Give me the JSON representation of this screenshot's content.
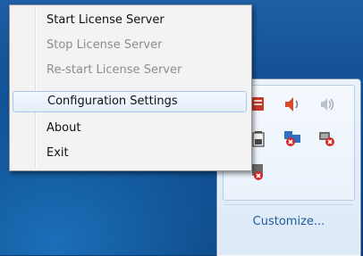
{
  "menu": {
    "items": [
      {
        "label": "Start License Server",
        "enabled": true
      },
      {
        "label": "Stop License Server",
        "enabled": false
      },
      {
        "label": "Re-start License Server",
        "enabled": false
      },
      {
        "label": "Configuration Settings",
        "enabled": true,
        "highlighted": true
      },
      {
        "label": "About",
        "enabled": true
      },
      {
        "label": "Exit",
        "enabled": true
      }
    ]
  },
  "tray": {
    "customize_label": "Customize...",
    "icons": [
      "license-server-icon",
      "volume-icon",
      "speaker-icon",
      "battery-icon",
      "network-error-icon",
      "network-disconnected-icon",
      "license-server-stopped-icon"
    ]
  },
  "colors": {
    "menu_bg": "#f3f3f3",
    "highlight_border": "#a9c7ea",
    "link": "#1b5aa0",
    "error_red": "#d42a2a"
  }
}
